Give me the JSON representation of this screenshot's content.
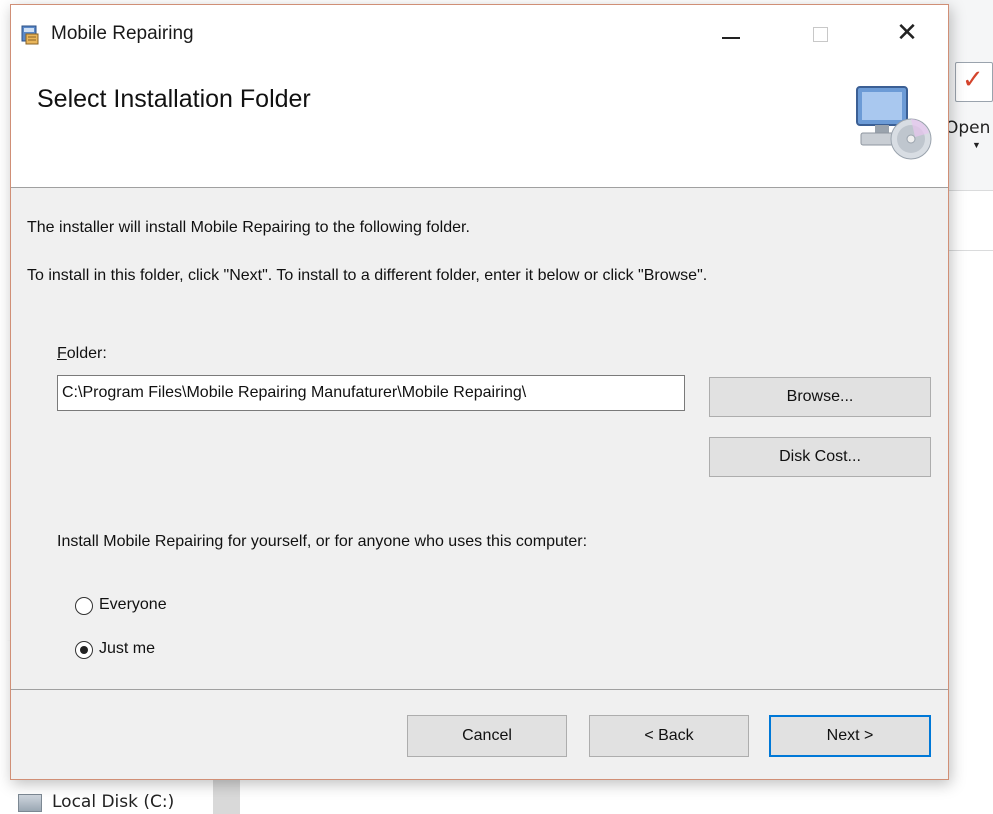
{
  "background": {
    "ribbon_open_label": "Open",
    "nav_item_label": "Local Disk (C:)"
  },
  "dialog": {
    "title": "Mobile Repairing",
    "window_controls": {
      "minimize": "minimize-icon",
      "maximize": "maximize-icon",
      "close": "✕"
    },
    "header_title": "Select Installation Folder",
    "description_line1": "The installer will install Mobile Repairing to the following folder.",
    "description_line2": "To install in this folder, click \"Next\". To install to a different folder, enter it below or click \"Browse\".",
    "folder_label_rest": "older:",
    "folder_label_mnemonic": "F",
    "folder_value": "C:\\Program Files\\Mobile Repairing Manufaturer\\Mobile Repairing\\",
    "browse_label": "Browse...",
    "disk_cost_label": "Disk Cost...",
    "install_for_text": "Install Mobile Repairing for yourself, or for anyone who uses this computer:",
    "radio_everyone_label": "Everyone",
    "radio_justme_label": "Just me",
    "selected_option": "Just me",
    "cancel_label": "Cancel",
    "back_label": "< Back",
    "next_label": "Next >"
  },
  "colors": {
    "dialog_border": "#d08f76",
    "default_button_border": "#0078d7",
    "check_accent": "#d4442c"
  }
}
